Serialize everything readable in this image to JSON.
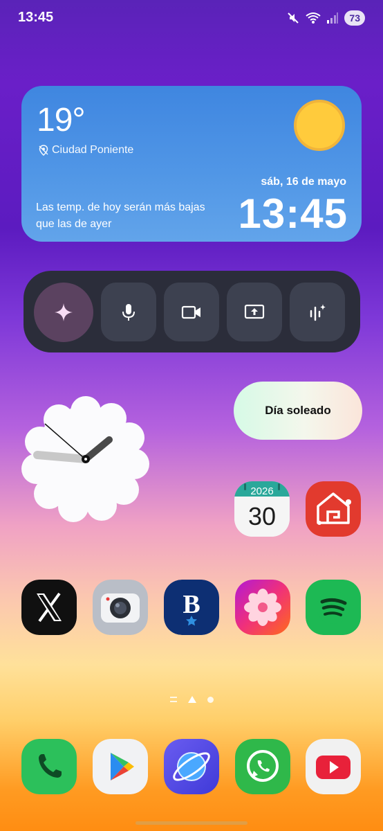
{
  "status_bar": {
    "time": "13:45",
    "battery": "73",
    "icons": [
      "mute-icon",
      "wifi-icon",
      "signal-icon",
      "battery-icon"
    ]
  },
  "weather": {
    "temperature": "19°",
    "location": "Ciudad Poniente",
    "date": "sáb, 16 de mayo",
    "time": "13:45",
    "description": "Las temp. de hoy serán más bajas que las de ayer"
  },
  "ai_toolbar": {
    "buttons": [
      "sparkle-icon",
      "microphone-icon",
      "video-icon",
      "screen-share-icon",
      "voice-wave-icon"
    ]
  },
  "weather_pill": {
    "label": "Día soleado"
  },
  "calendar_app": {
    "year": "2026",
    "day": "30"
  },
  "apps_row": [
    "x-app",
    "camera-app",
    "b-news-app",
    "photos-app",
    "spotify-app"
  ],
  "dock": [
    "phone-app",
    "play-store-app",
    "browser-app",
    "whatsapp-app",
    "youtube-app"
  ],
  "colors": {
    "weather_bg": "#4a90e2",
    "ai_bar_bg": "#2b2d3a",
    "sun": "#ffcb3c"
  }
}
